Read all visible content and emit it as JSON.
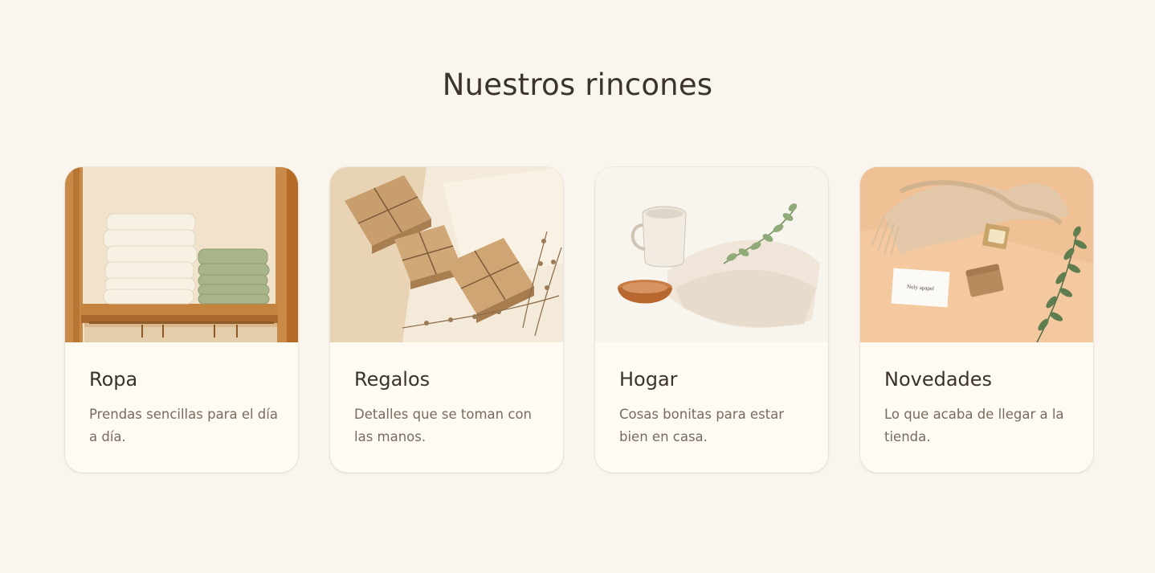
{
  "section": {
    "title": "Nuestros rincones"
  },
  "cards": [
    {
      "title": "Ropa",
      "description": "Prendas sencillas para el día a día.",
      "image": "folded-clothes-on-wooden-shelf"
    },
    {
      "title": "Regalos",
      "description": "Detalles que se toman con las manos.",
      "image": "kraft-gift-boxes-with-twine"
    },
    {
      "title": "Hogar",
      "description": "Cosas bonitas para estar bien en casa.",
      "image": "mug-bowl-and-linen-with-eucalyptus"
    },
    {
      "title": "Novedades",
      "description": "Lo que acaba de llegar a la tienda.",
      "image": "scarf-card-and-soap-flatlay",
      "image_card_text": "Noly apapel"
    }
  ],
  "colors": {
    "background": "#faf6ef",
    "card": "#fffaf2",
    "title": "#3b332d",
    "body_text": "#776b62"
  }
}
